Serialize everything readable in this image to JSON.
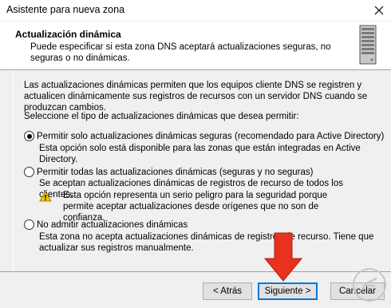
{
  "window": {
    "title": "Asistente para nueva zona"
  },
  "header": {
    "title": "Actualización dinámica",
    "description": "Puede especificar si esta zona DNS aceptará actualizaciones seguras, no seguras o no dinámicas."
  },
  "body": {
    "intro": "Las actualizaciones dinámicas permiten que los equipos cliente DNS se registren y actualicen dinámicamente sus registros de recursos con un servidor DNS cuando se produzcan cambios.",
    "prompt": "Seleccione el tipo de actualizaciones dinámicas que desea permitir:",
    "options": [
      {
        "label": "Permitir solo actualizaciones dinámicas seguras (recomendado para Active Directory)",
        "description": "Esta opción solo está disponible para las zonas que están integradas en Active Directory.",
        "selected": true
      },
      {
        "label": "Permitir todas las actualizaciones dinámicas (seguras y no seguras)",
        "description": "Se aceptan actualizaciones dinámicas de registros de recurso de todos los clientes.",
        "warning": "Esta opción representa un serio peligro para la seguridad porque permite aceptar actualizaciones desde orígenes que no son de confianza.",
        "selected": false
      },
      {
        "label": "No admitir actualizaciones dinámicas",
        "description": "Esta zona no acepta actualizaciones dinámicas de registros de recurso. Tiene que actualizar sus registros manualmente.",
        "selected": false
      }
    ]
  },
  "buttons": {
    "back": "< Atrás",
    "next": "Siguiente >",
    "cancel": "Cancelar"
  },
  "colors": {
    "accent": "#0078d7",
    "arrow": "#e8321e",
    "warning": "#f4c400"
  },
  "icons": [
    "close-icon",
    "server-icon",
    "warning-icon",
    "red-arrow-annotation",
    "watermark-logo"
  ]
}
